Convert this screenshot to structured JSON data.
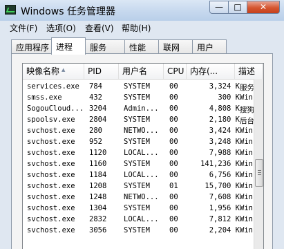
{
  "window": {
    "title": "Windows 任务管理器",
    "min_symbol": "—",
    "max_symbol": "□",
    "close_symbol": "✕"
  },
  "menu": [
    "文件(F)",
    "选项(O)",
    "查看(V)",
    "帮助(H)"
  ],
  "tabs": [
    {
      "label": "应用程序",
      "active": false
    },
    {
      "label": "进程",
      "active": true
    },
    {
      "label": "服务",
      "active": false
    },
    {
      "label": "性能",
      "active": false
    },
    {
      "label": "联网",
      "active": false
    },
    {
      "label": "用户",
      "active": false
    }
  ],
  "columns": [
    "映像名称",
    "PID",
    "用户名",
    "CPU",
    "内存(...",
    "描述"
  ],
  "processes": [
    {
      "name": "services.exe",
      "pid": "784",
      "user": "SYSTEM",
      "cpu": "00",
      "mem": "3,324 K",
      "desc": "服务"
    },
    {
      "name": "smss.exe",
      "pid": "432",
      "user": "SYSTEM",
      "cpu": "00",
      "mem": "300 K",
      "desc": "Win"
    },
    {
      "name": "SogouCloud...",
      "pid": "3204",
      "user": "Admin...",
      "cpu": "00",
      "mem": "4,808 K",
      "desc": "搜狗"
    },
    {
      "name": "spoolsv.exe",
      "pid": "2804",
      "user": "SYSTEM",
      "cpu": "00",
      "mem": "2,180 K",
      "desc": "后台"
    },
    {
      "name": "svchost.exe",
      "pid": "280",
      "user": "NETWO...",
      "cpu": "00",
      "mem": "3,424 K",
      "desc": "Win"
    },
    {
      "name": "svchost.exe",
      "pid": "952",
      "user": "SYSTEM",
      "cpu": "00",
      "mem": "3,248 K",
      "desc": "Win"
    },
    {
      "name": "svchost.exe",
      "pid": "1120",
      "user": "LOCAL...",
      "cpu": "00",
      "mem": "7,988 K",
      "desc": "Win"
    },
    {
      "name": "svchost.exe",
      "pid": "1160",
      "user": "SYSTEM",
      "cpu": "00",
      "mem": "141,236 K",
      "desc": "Win"
    },
    {
      "name": "svchost.exe",
      "pid": "1184",
      "user": "LOCAL...",
      "cpu": "00",
      "mem": "6,756 K",
      "desc": "Win"
    },
    {
      "name": "svchost.exe",
      "pid": "1208",
      "user": "SYSTEM",
      "cpu": "01",
      "mem": "15,700 K",
      "desc": "Win"
    },
    {
      "name": "svchost.exe",
      "pid": "1248",
      "user": "NETWO...",
      "cpu": "00",
      "mem": "7,608 K",
      "desc": "Win"
    },
    {
      "name": "svchost.exe",
      "pid": "1304",
      "user": "SYSTEM",
      "cpu": "00",
      "mem": "1,956 K",
      "desc": "Win"
    },
    {
      "name": "svchost.exe",
      "pid": "2832",
      "user": "LOCAL...",
      "cpu": "00",
      "mem": "7,812 K",
      "desc": "Win"
    },
    {
      "name": "svchost.exe",
      "pid": "3056",
      "user": "SYSTEM",
      "cpu": "00",
      "mem": "2,204 K",
      "desc": "Win"
    }
  ]
}
